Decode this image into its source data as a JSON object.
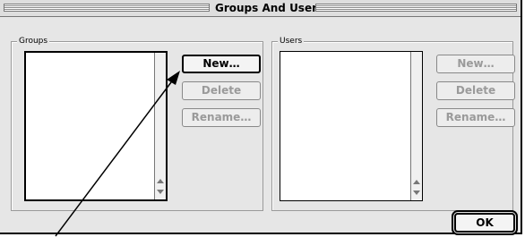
{
  "window": {
    "title": "Groups And Users"
  },
  "groups_panel": {
    "label": "Groups",
    "buttons": {
      "new": "New…",
      "delete": "Delete",
      "rename": "Rename…"
    }
  },
  "users_panel": {
    "label": "Users",
    "buttons": {
      "new": "New…",
      "delete": "Delete",
      "rename": "Rename…"
    }
  },
  "footer": {
    "ok": "OK"
  }
}
